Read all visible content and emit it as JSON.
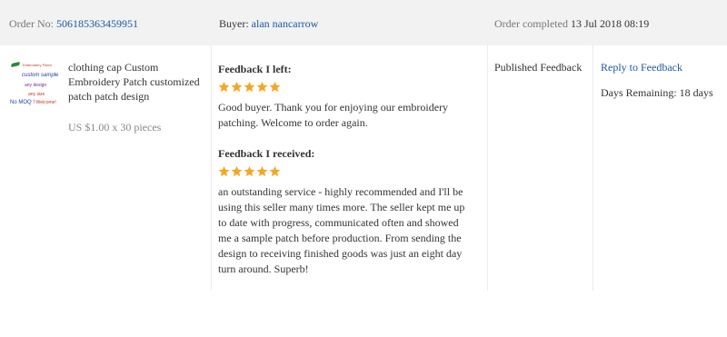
{
  "order": {
    "order_no_label": "Order No:",
    "order_no": "506185363459951",
    "buyer_label": "Buyer:",
    "buyer_name": "alan nancarrow",
    "completed_label": "Order completed",
    "completed_date": "13 Jul 2018 08:19"
  },
  "product": {
    "image_lines": [
      "Embroidery Patch",
      "custom sample",
      "any design",
      "any size",
      "No MOQ ! ",
      "Welcome!"
    ],
    "title": "clothing cap Custom Embroidery Patch customized patch patch design",
    "price": "US $1.00 x 30 pieces"
  },
  "feedback_left": {
    "title": "Feedback I left:",
    "stars": 5,
    "text": "Good buyer. Thank you for enjoying our embroidery patching. Welcome to order again."
  },
  "feedback_received": {
    "title": "Feedback I received:",
    "stars": 5,
    "text": "an outstanding service - highly recommended and I'll be using this seller many times more. The seller kept me up to date with progress, communicated often and showed me a sample patch before production. From sending the design to receiving finished goods was just an eight day turn around. Superb!"
  },
  "status": {
    "published": "Published Feedback"
  },
  "actions": {
    "reply_label": "Reply to Feedback",
    "days_remaining": "Days Remaining: 18 days"
  },
  "colors": {
    "star": "#f5a623",
    "link": "#1a57a8",
    "header_bg": "#f2f2f2"
  }
}
